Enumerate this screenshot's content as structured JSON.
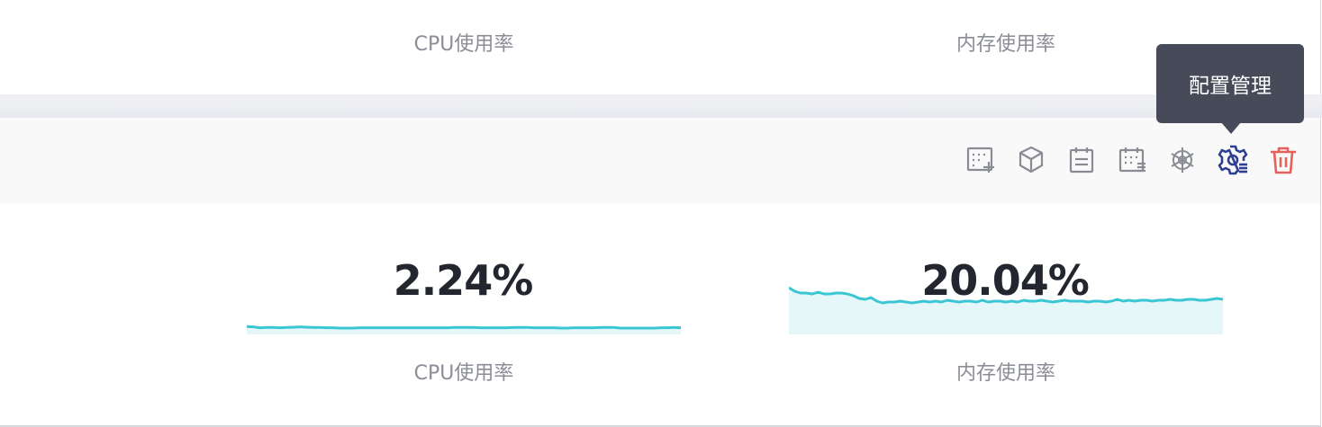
{
  "top_card": {
    "cpu_label": "CPU使用率",
    "mem_label": "内存使用率"
  },
  "toolbar": {
    "icons": [
      {
        "name": "add-grid-icon",
        "color": "#8a8c94"
      },
      {
        "name": "cube-icon",
        "color": "#8a8c94"
      },
      {
        "name": "notepad-icon",
        "color": "#8a8c94"
      },
      {
        "name": "calendar-list-icon",
        "color": "#8a8c94"
      },
      {
        "name": "helm-icon",
        "color": "#8a8c94"
      },
      {
        "name": "gear-settings-icon",
        "color": "#2f3f8f"
      },
      {
        "name": "trash-icon",
        "color": "#e8605a"
      }
    ],
    "tooltip": "配置管理"
  },
  "main": {
    "cpu": {
      "value": "2.24%",
      "label": "CPU使用率",
      "series": [
        2.5,
        2.4,
        2.1,
        2.2,
        2.2,
        2.1,
        2.2,
        2.3,
        2.4,
        2.3,
        2.2,
        2.2,
        2.1,
        2.1,
        2.0,
        2.0,
        2.0,
        2.1,
        2.1,
        2.1,
        2.1,
        2.1,
        2.1,
        2.1,
        2.1,
        2.1,
        2.1,
        2.1,
        2.1,
        2.1,
        2.1,
        2.2,
        2.2,
        2.2,
        2.2,
        2.1,
        2.1,
        2.1,
        2.1,
        2.1,
        2.2,
        2.2,
        2.2,
        2.1,
        2.1,
        2.1,
        2.1,
        2.0,
        2.0,
        2.1,
        2.1,
        2.1,
        2.1,
        2.2,
        2.2,
        2.2,
        2.0,
        2.0,
        2.0,
        2.0,
        2.0,
        2.0,
        2.1,
        2.1,
        2.2,
        2.1
      ]
    },
    "mem": {
      "value": "20.04%",
      "label": "内存使用率",
      "series": [
        5.2,
        4.8,
        4.6,
        4.6,
        4.5,
        4.7,
        4.5,
        4.5,
        4.6,
        4.6,
        4.5,
        4.3,
        4.0,
        3.9,
        4.1,
        3.7,
        3.5,
        3.6,
        3.6,
        3.7,
        3.6,
        3.5,
        3.6,
        3.7,
        3.6,
        3.7,
        3.6,
        3.8,
        3.7,
        3.6,
        3.7,
        3.7,
        3.6,
        3.8,
        3.6,
        3.7,
        3.7,
        3.6,
        3.7,
        3.6,
        3.8,
        3.7,
        3.7,
        3.8,
        3.7,
        3.6,
        3.7,
        3.8,
        3.7,
        3.7,
        3.7,
        3.6,
        3.7,
        3.7,
        3.6,
        3.7,
        3.9,
        3.7,
        3.8,
        3.7,
        3.8,
        3.8,
        3.7,
        3.8,
        3.8,
        3.9,
        3.8,
        3.8,
        3.9,
        3.9,
        3.8,
        3.8,
        3.9,
        4.0,
        3.9
      ]
    }
  },
  "colors": {
    "spark_line": "#3bc6d4",
    "spark_fill": "#e6f7f9"
  }
}
